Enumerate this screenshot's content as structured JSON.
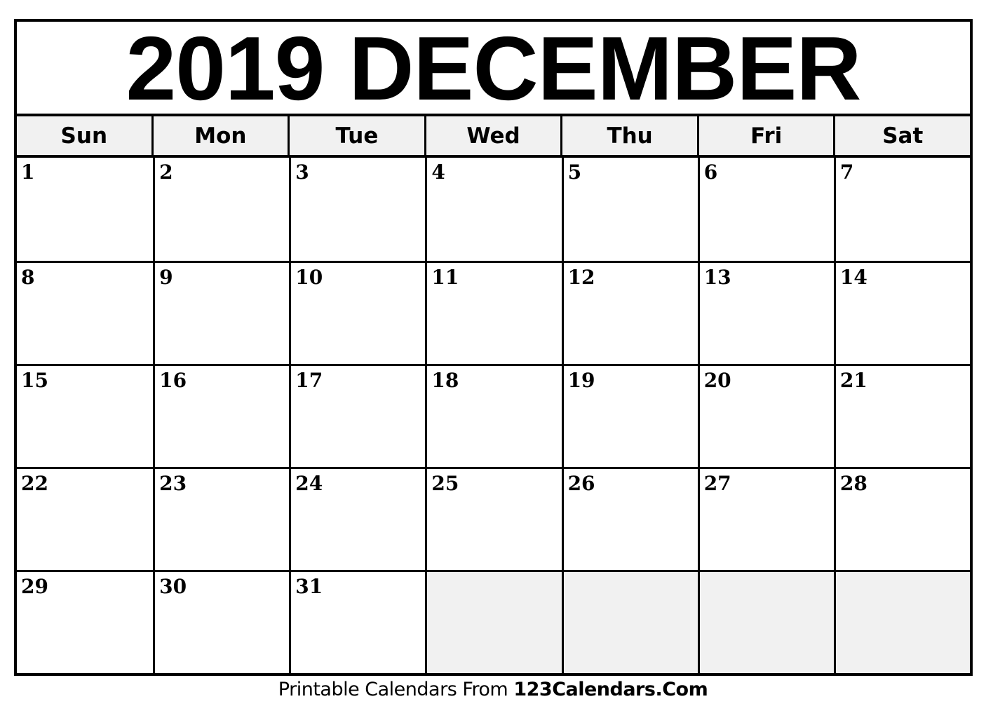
{
  "calendar": {
    "title": "2019 DECEMBER",
    "year": 2019,
    "month": "DECEMBER",
    "weekdays": [
      "Sun",
      "Mon",
      "Tue",
      "Wed",
      "Thu",
      "Fri",
      "Sat"
    ],
    "weeks": [
      [
        "1",
        "2",
        "3",
        "4",
        "5",
        "6",
        "7"
      ],
      [
        "8",
        "9",
        "10",
        "11",
        "12",
        "13",
        "14"
      ],
      [
        "15",
        "16",
        "17",
        "18",
        "19",
        "20",
        "21"
      ],
      [
        "22",
        "23",
        "24",
        "25",
        "26",
        "27",
        "28"
      ],
      [
        "29",
        "30",
        "31",
        "",
        "",
        "",
        ""
      ]
    ],
    "empty_cell_color": "#f1f1f1",
    "header_band_color": "#f1f1f1"
  },
  "footer": {
    "prefix": "Printable Calendars From ",
    "brand": "123Calendars.Com"
  }
}
